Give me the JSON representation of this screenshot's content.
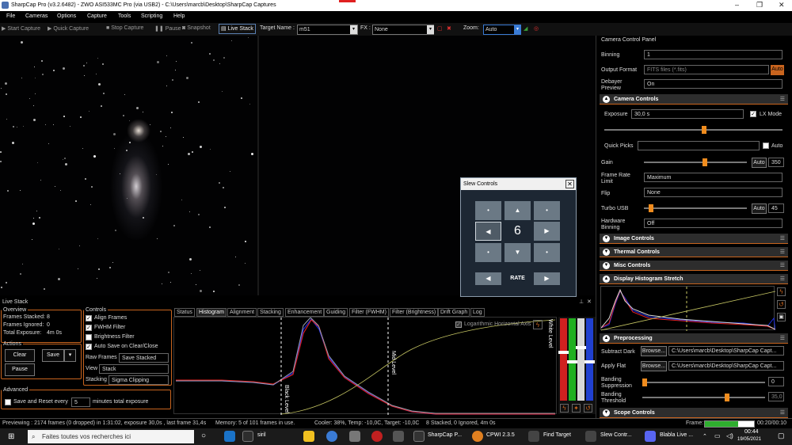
{
  "titlebar": {
    "title": "SharpCap Pro (v3.2.6482) - ZWO ASI533MC Pro (via USB2) - C:\\Users\\marcb\\Desktop\\SharpCap Captures"
  },
  "menu": [
    "File",
    "Cameras",
    "Options",
    "Capture",
    "Tools",
    "Scripting",
    "Help"
  ],
  "toolbar": {
    "start_capture": "Start Capture",
    "quick_capture": "Quick Capture",
    "stop_capture": "Stop Capture",
    "pause": "Pause",
    "snapshot": "Snapshot",
    "live_stack": "Live Stack",
    "target_label": "Target Name :",
    "target_value": "m51",
    "fx_label": "FX :",
    "fx_value": "None",
    "zoom_label": "Zoom:",
    "zoom_value": "Auto"
  },
  "slew": {
    "title": "Slew Controls",
    "rate_value": "6",
    "rate_label": "RATE"
  },
  "livestack": {
    "panel_title": "Live Stack",
    "overview_legend": "Overview",
    "frames_stacked_label": "Frames Stacked:",
    "frames_stacked": "8",
    "frames_ignored_label": "Frames Ignored:",
    "frames_ignored": "0",
    "total_exposure_label": "Total Exposure:",
    "total_exposure": "4m 0s",
    "actions_legend": "Actions",
    "clear": "Clear",
    "save": "Save",
    "pause": "Pause",
    "advanced_legend": "Advanced",
    "save_reset_label": "Save and Reset every",
    "save_reset_value": "5",
    "minutes_label": "minutes total exposure",
    "controls_legend": "Controls",
    "align_frames": "Align Frames",
    "fwhm_filter": "FWHM Filter",
    "brightness_filter": "Brightness Filter",
    "auto_save": "Auto Save on Clear/Close",
    "raw_frames_label": "Raw Frames",
    "raw_frames_value": "Save Stacked",
    "view_label": "View",
    "view_value": "Stack",
    "stacking_label": "Stacking",
    "stacking_value": "Sigma Clipping"
  },
  "tabs": [
    "Status",
    "Histogram",
    "Alignment",
    "Stacking",
    "Enhancement",
    "Guiding",
    "Filter (FWHM)",
    "Filter (Brightness)",
    "Drift Graph",
    "Log"
  ],
  "histogram": {
    "log_axis_label": "Logarithmic Horizontal Axis",
    "black_level": "Black Level",
    "mid_level": "Mid Level",
    "white_level": "White Level"
  },
  "status": {
    "previewing": "Previewing : 2174 frames (0 dropped) in 1:31:02, exposure 30,0s , last frame 31,4s",
    "memory": "Memory: 5 of 101 frames in use.",
    "cooler": "Cooler: 38%, Temp: -10,0C, Target: -10,0C",
    "stacked": "8 Stacked, 0 Ignored, 4m 0s",
    "frame_label": "Frame:",
    "frame_time": "00:20/00:10"
  },
  "right": {
    "panel_title": "Camera Control Panel",
    "binning_label": "Binning",
    "binning_value": "1",
    "output_label": "Output Format",
    "output_value": "FITS files (*.fits)",
    "output_auto": "Auto",
    "debayer_label": "Debayer Preview",
    "debayer_value": "On",
    "camera_controls": "Camera Controls",
    "exposure_label": "Exposure",
    "exposure_value": "30,0 s",
    "lx_mode": "LX Mode",
    "quick_picks": "Quick Picks",
    "quick_auto": "Auto",
    "gain_label": "Gain",
    "gain_auto": "Auto",
    "gain_value": "350",
    "frame_rate_label": "Frame Rate Limit",
    "frame_rate_value": "Maximum",
    "flip_label": "Flip",
    "flip_value": "None",
    "turbo_label": "Turbo USB",
    "turbo_auto": "Auto",
    "turbo_value": "45",
    "hw_binning_label": "Hardware Binning",
    "hw_binning_value": "Off",
    "image_controls": "Image Controls",
    "thermal_controls": "Thermal Controls",
    "misc_controls": "Misc Controls",
    "display_histogram": "Display Histogram Stretch",
    "preprocessing": "Preprocessing",
    "subtract_dark_label": "Subtract Dark",
    "browse": "Browse...",
    "subtract_dark_path": "C:\\Users\\marcb\\Desktop\\SharpCap Capt...",
    "apply_flat_label": "Apply Flat",
    "apply_flat_path": "C:\\Users\\marcb\\Desktop\\SharpCap Capt...",
    "banding_supp_label": "Banding Suppression",
    "banding_supp_value": "0",
    "banding_thr_label": "Banding Threshold",
    "banding_thr_value": "35,0",
    "scope_controls": "Scope Controls"
  },
  "taskbar": {
    "search": "Faites toutes vos recherches ici",
    "siril": "siril",
    "sharpcap": "SharpCap P...",
    "cpwi": "CPWI 2.3.5",
    "find_target": "Find Target",
    "slew_controls": "Slew Contr...",
    "blabla": "Blabla Live ...",
    "time": "00:44",
    "date": "19/05/2021"
  },
  "colors": {
    "accent": "#c8641e",
    "thumb": "#f08c1e",
    "frame_progress": "#2fae2f"
  },
  "slider_levels": {
    "exposure": 0.56,
    "gain": 0.6,
    "turbo": 0.05,
    "banding_suppression": 0.0,
    "banding_threshold": 0.7,
    "frame_progress": 0.67
  }
}
